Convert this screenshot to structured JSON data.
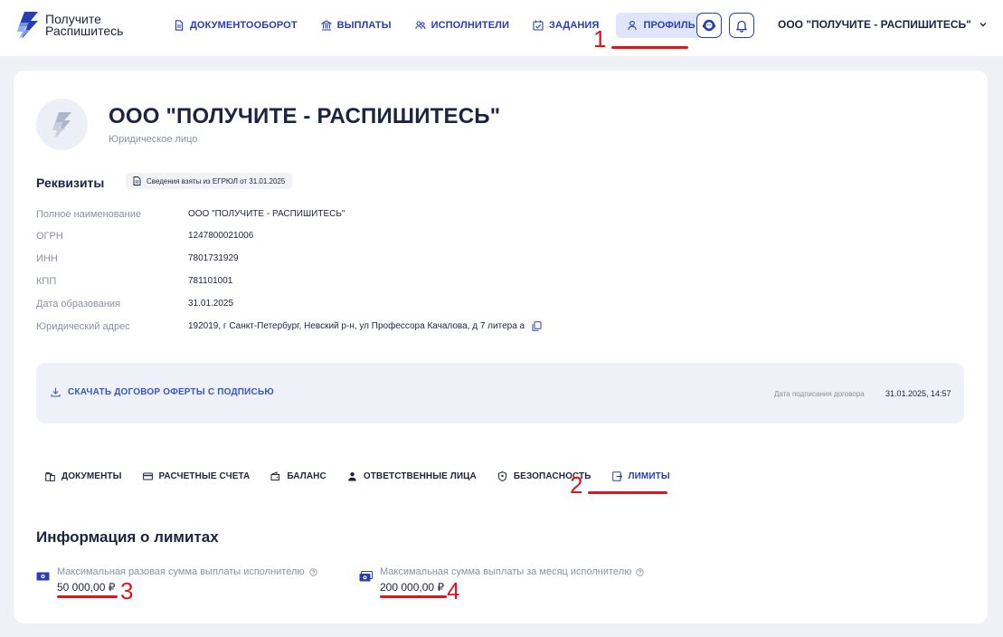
{
  "header": {
    "logo_line1": "Получите",
    "logo_line2": "Распишитесь",
    "nav": [
      {
        "label": "ДОКУМЕНТООБОРОТ",
        "icon": "document-icon"
      },
      {
        "label": "ВЫПЛАТЫ",
        "icon": "bank-icon"
      },
      {
        "label": "ИСПОЛНИТЕЛИ",
        "icon": "users-icon"
      },
      {
        "label": "ЗАДАНИЯ",
        "icon": "calendar-check-icon"
      },
      {
        "label": "ПРОФИЛЬ",
        "icon": "user-icon",
        "active": true
      }
    ],
    "org_name": "ООО \"ПОЛУЧИТЕ - РАСПИШИТЕСЬ\""
  },
  "company": {
    "name": "ООО \"ПОЛУЧИТЕ - РАСПИШИТЕСЬ\"",
    "type": "Юридическое лицо"
  },
  "requisites": {
    "title": "Реквизиты",
    "egrul_badge": "Сведения взяты из ЕГРЮЛ от 31.01.2025",
    "rows": [
      {
        "label": "Полное наименование",
        "value": "ООО \"ПОЛУЧИТЕ - РАСПИШИТЕСЬ\""
      },
      {
        "label": "ОГРН",
        "value": "1247800021006"
      },
      {
        "label": "ИНН",
        "value": "7801731929"
      },
      {
        "label": "КПП",
        "value": "781101001"
      },
      {
        "label": "Дата образования",
        "value": "31.01.2025"
      },
      {
        "label": "Юридический адрес",
        "value": "192019, г Санкт-Петербург, Невский р-н, ул Профессора Качалова, д 7 литера а"
      }
    ]
  },
  "contract": {
    "download_label": "СКАЧАТЬ ДОГОВОР ОФЕРТЫ С ПОДПИСЬЮ",
    "sign_date_label": "Дата подписания договора",
    "sign_date_value": "31.01.2025, 14:57"
  },
  "tabs": [
    {
      "label": "ДОКУМЕНТЫ",
      "icon": "folder-doc-icon"
    },
    {
      "label": "РАСЧЕТНЫЕ СЧЕТА",
      "icon": "card-icon"
    },
    {
      "label": "БАЛАНС",
      "icon": "wallet-icon"
    },
    {
      "label": "ОТВЕТСТВЕННЫЕ ЛИЦА",
      "icon": "person-icon"
    },
    {
      "label": "БЕЗОПАСНОСТЬ",
      "icon": "shield-icon"
    },
    {
      "label": "ЛИМИТЫ",
      "icon": "limits-icon",
      "active": true
    }
  ],
  "limits": {
    "title": "Информация о лимитах",
    "items": [
      {
        "label": "Максимальная разовая сумма выплаты исполнителю",
        "value": "50 000,00 ₽"
      },
      {
        "label": "Максимальная сумма выплаты за месяц исполнителю",
        "value": "200 000,00 ₽"
      }
    ]
  },
  "annotations": [
    "1",
    "2",
    "3",
    "4"
  ],
  "colors": {
    "accent": "#2a3eb1",
    "annotation": "#e4141b",
    "background": "#eef1f6"
  }
}
